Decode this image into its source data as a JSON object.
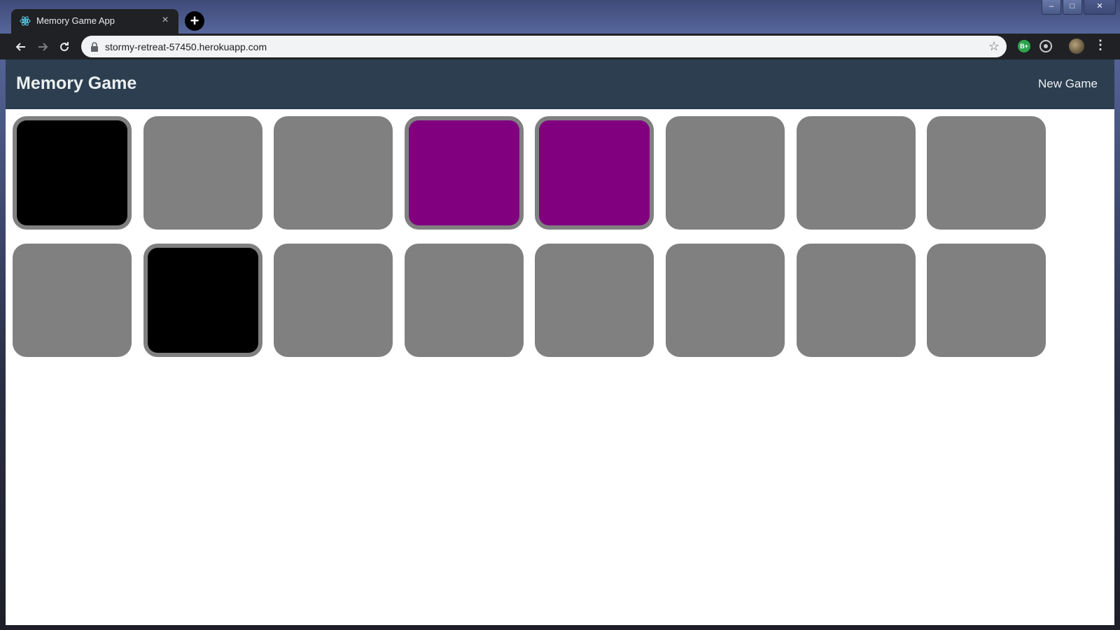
{
  "browser": {
    "tab_title": "Memory Game App",
    "tab_close": "×",
    "new_tab": "+",
    "url": "stormy-retreat-57450.herokuapp.com",
    "window_controls": {
      "minimize": "–",
      "maximize": "□",
      "close": "✕"
    },
    "extension_b_label": "B+"
  },
  "app": {
    "title": "Memory Game",
    "new_game_label": "New Game"
  },
  "colors": {
    "header_bg": "#2c3e50",
    "card_back": "#808080",
    "black": "#000000",
    "purple": "#800080"
  },
  "cards": [
    {
      "row": 1,
      "col": 1,
      "state": "revealed",
      "color": "#000000"
    },
    {
      "row": 1,
      "col": 2,
      "state": "hidden"
    },
    {
      "row": 1,
      "col": 3,
      "state": "hidden"
    },
    {
      "row": 1,
      "col": 4,
      "state": "revealed",
      "color": "#800080"
    },
    {
      "row": 1,
      "col": 5,
      "state": "revealed",
      "color": "#800080"
    },
    {
      "row": 1,
      "col": 6,
      "state": "hidden"
    },
    {
      "row": 1,
      "col": 7,
      "state": "hidden"
    },
    {
      "row": 1,
      "col": 8,
      "state": "hidden"
    },
    {
      "row": 2,
      "col": 1,
      "state": "hidden"
    },
    {
      "row": 2,
      "col": 2,
      "state": "revealed",
      "color": "#000000"
    },
    {
      "row": 2,
      "col": 3,
      "state": "hidden"
    },
    {
      "row": 2,
      "col": 4,
      "state": "hidden"
    },
    {
      "row": 2,
      "col": 5,
      "state": "hidden"
    },
    {
      "row": 2,
      "col": 6,
      "state": "hidden"
    },
    {
      "row": 2,
      "col": 7,
      "state": "hidden"
    },
    {
      "row": 2,
      "col": 8,
      "state": "hidden"
    }
  ]
}
